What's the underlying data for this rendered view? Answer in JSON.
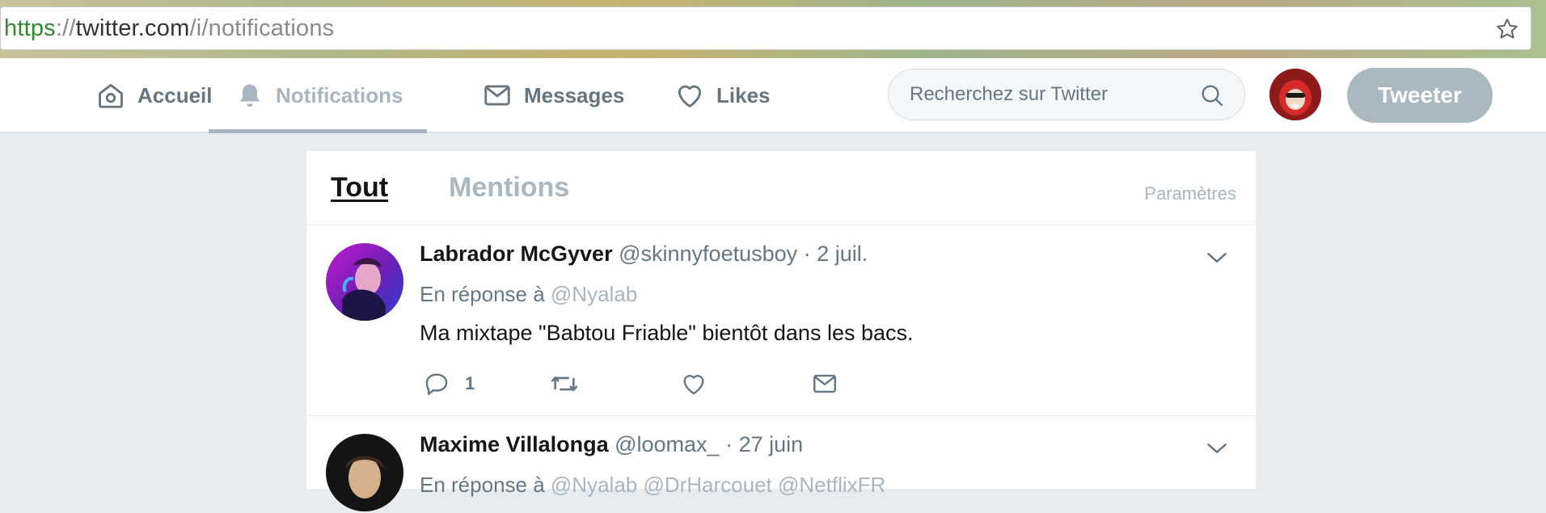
{
  "browser": {
    "url_scheme": "https",
    "url_sep": "://",
    "url_host": "twitter.com",
    "url_path": "/i/notifications"
  },
  "nav": {
    "items": [
      {
        "label": "Accueil",
        "icon": "home-icon"
      },
      {
        "label": "Notifications",
        "icon": "bell-icon",
        "active": true
      },
      {
        "label": "Messages",
        "icon": "envelope-icon"
      },
      {
        "label": "Likes",
        "icon": "heart-icon"
      }
    ],
    "search_placeholder": "Recherchez sur Twitter",
    "tweet_button": "Tweeter"
  },
  "notifications": {
    "tabs": [
      "Tout",
      "Mentions"
    ],
    "settings_label": "Paramètres"
  },
  "tweets": [
    {
      "name": "Labrador McGyver",
      "handle": "@skinnyfoetusboy",
      "dot": "·",
      "date": "2 juil.",
      "reply_prefix": "En réponse à",
      "reply_mentions": "@Nyalab",
      "text": "Ma mixtape \"Babtou Friable\" bientôt dans les bacs.",
      "reply_count": "1"
    },
    {
      "name": "Maxime Villalonga",
      "handle": "@loomax_",
      "dot": "·",
      "date": "27 juin",
      "reply_prefix": "En réponse à",
      "reply_mentions": "@Nyalab @DrHarcouet @NetflixFR"
    }
  ],
  "colors": {
    "accent_muted": "#aab8c2",
    "text_primary": "#14171a",
    "text_secondary": "#657786",
    "page_bg": "#e6ecf0"
  }
}
